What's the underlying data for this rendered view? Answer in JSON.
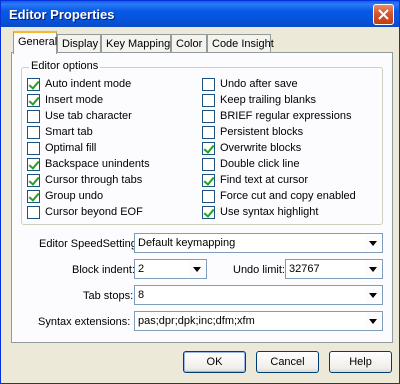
{
  "window": {
    "title": "Editor Properties"
  },
  "tabs": [
    {
      "label": "General",
      "active": true
    },
    {
      "label": "Display",
      "active": false
    },
    {
      "label": "Key Mappings",
      "active": false
    },
    {
      "label": "Color",
      "active": false
    },
    {
      "label": "Code Insight",
      "active": false
    }
  ],
  "editor_options": {
    "group_label": "Editor options",
    "left": [
      {
        "label": "Auto indent mode",
        "checked": true
      },
      {
        "label": "Insert mode",
        "checked": true
      },
      {
        "label": "Use tab character",
        "checked": false
      },
      {
        "label": "Smart tab",
        "checked": false
      },
      {
        "label": "Optimal fill",
        "checked": false
      },
      {
        "label": "Backspace unindents",
        "checked": true
      },
      {
        "label": "Cursor through tabs",
        "checked": true
      },
      {
        "label": "Group undo",
        "checked": true
      },
      {
        "label": "Cursor beyond EOF",
        "checked": false
      }
    ],
    "right": [
      {
        "label": "Undo after save",
        "checked": false
      },
      {
        "label": "Keep trailing blanks",
        "checked": false
      },
      {
        "label": "BRIEF regular expressions",
        "checked": false
      },
      {
        "label": "Persistent blocks",
        "checked": false
      },
      {
        "label": "Overwrite blocks",
        "checked": true
      },
      {
        "label": "Double click line",
        "checked": false
      },
      {
        "label": "Find text at cursor",
        "checked": true
      },
      {
        "label": "Force cut and copy enabled",
        "checked": false
      },
      {
        "label": "Use syntax highlight",
        "checked": true
      }
    ]
  },
  "fields": {
    "speedsetting": {
      "label": "Editor SpeedSetting:",
      "value": "Default keymapping"
    },
    "block_indent": {
      "label": "Block indent:",
      "value": "2"
    },
    "undo_limit": {
      "label": "Undo limit:",
      "value": "32767"
    },
    "tab_stops": {
      "label": "Tab stops:",
      "value": "8"
    },
    "syntax_extensions": {
      "label": "Syntax extensions:",
      "value": "pas;dpr;dpk;inc;dfm;xfm"
    }
  },
  "buttons": {
    "ok": "OK",
    "cancel": "Cancel",
    "help": "Help"
  },
  "colors": {
    "titlebar": "#0558e0",
    "dialog_bg": "#ece9d8",
    "check": "#21a121",
    "tab_highlight": "#f5b832"
  }
}
